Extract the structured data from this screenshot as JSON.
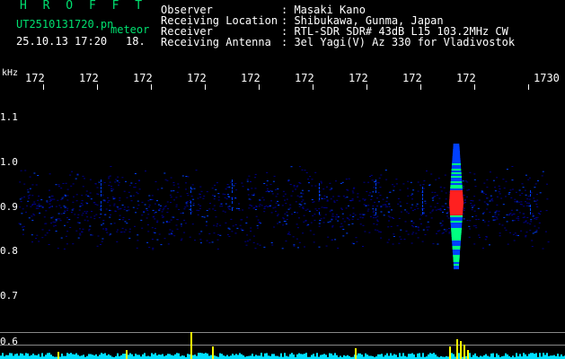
{
  "header": {
    "brand": "H R O F F T",
    "filename": "UT2510131720.pn",
    "tag": "meteor",
    "datetime": "25.10.13 17:20",
    "seconds": "18.",
    "info": [
      {
        "label": "Observer",
        "value": ": Masaki Kano"
      },
      {
        "label": "Receiving Location",
        "value": ": Shibukawa, Gunma, Japan"
      },
      {
        "label": "Receiver",
        "value": ": RTL-SDR SDR# 43dB L15 103.2MHz CW"
      },
      {
        "label": "Receiving Antenna",
        "value": ": 3el Yagi(V) Az 330 for Vladivostok"
      }
    ]
  },
  "axes": {
    "unit": "kHz",
    "x_ticks": [
      "172",
      "172",
      "172",
      "172",
      "172",
      "172",
      "172",
      "172",
      "172",
      "1730"
    ],
    "y_ticks": [
      "1.1",
      "1.0",
      "0.9",
      "0.8",
      "0.7",
      "0.6"
    ]
  },
  "colors": {
    "background": "#000000",
    "noise_low": "#00008a",
    "noise_mid": "#0040ff",
    "echo_hot": "#ff2020",
    "echo_mid": "#00ff80",
    "trace": "#00e0ff",
    "spike": "#ffff00"
  }
}
